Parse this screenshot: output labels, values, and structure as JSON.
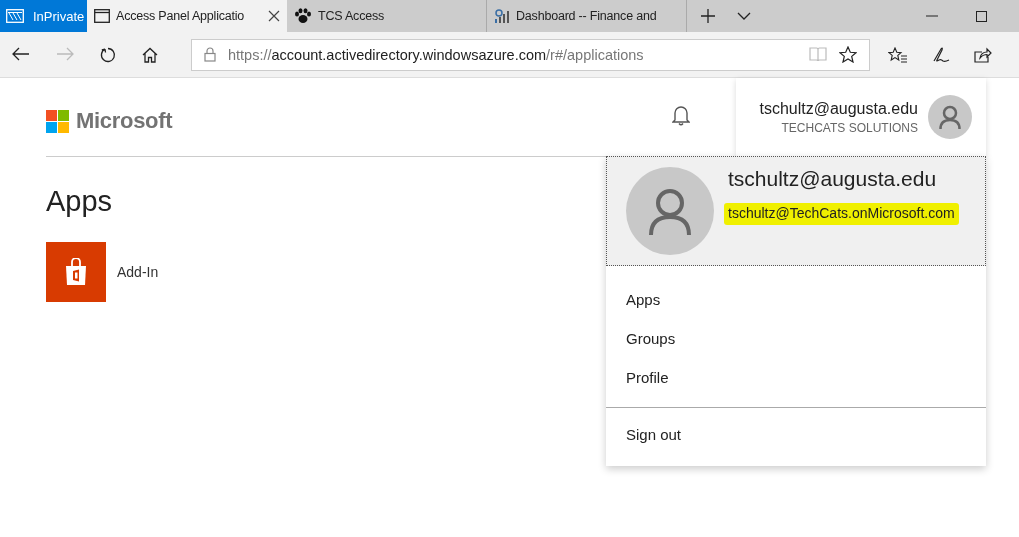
{
  "browser": {
    "inprivate_label": "InPrivate",
    "tabs": [
      {
        "title": "Access Panel Applicatio",
        "selected": true,
        "closable": true
      },
      {
        "title": "TCS Access",
        "selected": false,
        "closable": false
      },
      {
        "title": "Dashboard -- Finance and",
        "selected": false,
        "closable": false
      }
    ],
    "address": {
      "scheme": "https://",
      "host": "account.activedirectory.windowsazure.com",
      "path": "/r#/applications"
    }
  },
  "header": {
    "brand": "Microsoft",
    "user": {
      "email": "tschultz@augusta.edu",
      "organization": "TECHCATS SOLUTIONS"
    }
  },
  "page": {
    "title": "Apps",
    "apps": [
      {
        "name": "Add-In",
        "color": "#d83b01"
      }
    ]
  },
  "account_menu": {
    "name": "tschultz@augusta.edu",
    "email": "tschultz@TechCats.onMicrosoft.com",
    "email_highlighted": true,
    "items": [
      {
        "label": "Apps",
        "kind": "link"
      },
      {
        "label": "Groups",
        "kind": "link"
      },
      {
        "label": "Profile",
        "kind": "link"
      },
      {
        "label": "Sign out",
        "kind": "signout"
      }
    ]
  }
}
